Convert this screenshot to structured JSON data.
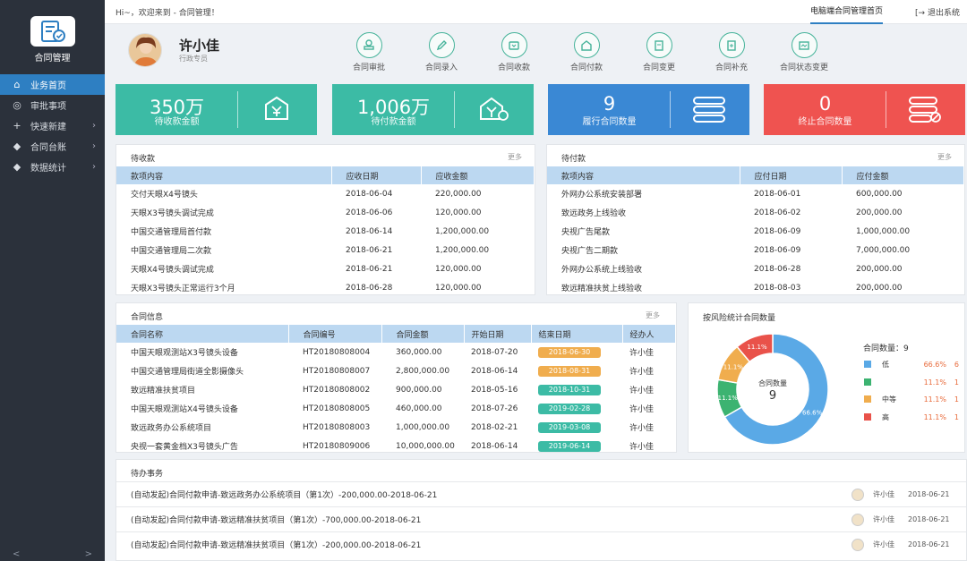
{
  "sidebar": {
    "title": "合同管理",
    "items": [
      {
        "label": "业务首页",
        "icon": "home-icon",
        "active": true,
        "has_arrow": false
      },
      {
        "label": "审批事项",
        "icon": "approval-icon",
        "active": false,
        "has_arrow": false
      },
      {
        "label": "快速新建",
        "icon": "plus-icon",
        "active": false,
        "has_arrow": true
      },
      {
        "label": "合同台账",
        "icon": "ledger-icon",
        "active": false,
        "has_arrow": true
      },
      {
        "label": "数据统计",
        "icon": "stats-icon",
        "active": false,
        "has_arrow": true
      }
    ],
    "foot_left": "<",
    "foot_right": ">"
  },
  "topbar": {
    "welcome": "Hi~，欢迎来到 - 合同管理！",
    "home_link": "电脑端合同管理首页",
    "logout": "退出系统"
  },
  "profile": {
    "name": "许小佳",
    "role": "行政专员"
  },
  "quick_actions": [
    {
      "label": "合同审批",
      "icon": "stamp-icon"
    },
    {
      "label": "合同录入",
      "icon": "pen-icon"
    },
    {
      "label": "合同收款",
      "icon": "receive-icon"
    },
    {
      "label": "合同付款",
      "icon": "pay-icon"
    },
    {
      "label": "合同变更",
      "icon": "change-icon"
    },
    {
      "label": "合同补充",
      "icon": "supplement-icon"
    },
    {
      "label": "合同状态变更",
      "icon": "status-icon"
    }
  ],
  "stats": [
    {
      "value": "350万",
      "label": "待收款金额",
      "color": "#3cbba5",
      "icon": "money-in-icon"
    },
    {
      "value": "1,006万",
      "label": "待付款金额",
      "color": "#3cbba5",
      "icon": "money-out-icon"
    },
    {
      "value": "9",
      "label": "履行合同数量",
      "color": "#3a88d4",
      "icon": "server-icon"
    },
    {
      "value": "0",
      "label": "终止合同数量",
      "color": "#ef5350",
      "icon": "server-block-icon"
    }
  ],
  "receivable": {
    "title": "待收款",
    "more": "更多",
    "headers": [
      "款项内容",
      "应收日期",
      "应收金额"
    ],
    "rows": [
      [
        "交付天眼X4号镜头",
        "2018-06-04",
        "220,000.00"
      ],
      [
        "天眼X3号镜头调试完成",
        "2018-06-06",
        "120,000.00"
      ],
      [
        "中国交通管理局首付款",
        "2018-06-14",
        "1,200,000.00"
      ],
      [
        "中国交通管理局二次款",
        "2018-06-21",
        "1,200,000.00"
      ],
      [
        "天眼X4号镜头调试完成",
        "2018-06-21",
        "120,000.00"
      ],
      [
        "天眼X3号镜头正常运行3个月",
        "2018-06-28",
        "120,000.00"
      ]
    ]
  },
  "payable": {
    "title": "待付款",
    "more": "更多",
    "headers": [
      "款项内容",
      "应付日期",
      "应付金额"
    ],
    "rows": [
      [
        "外网办公系统安装部署",
        "2018-06-01",
        "600,000.00"
      ],
      [
        "致远政务上线验收",
        "2018-06-02",
        "200,000.00"
      ],
      [
        "央视广告尾款",
        "2018-06-09",
        "1,000,000.00"
      ],
      [
        "央视广告二期款",
        "2018-06-09",
        "7,000,000.00"
      ],
      [
        "外网办公系统上线验收",
        "2018-06-28",
        "200,000.00"
      ],
      [
        "致远精准扶贫上线验收",
        "2018-08-03",
        "200,000.00"
      ]
    ]
  },
  "contracts": {
    "title": "合同信息",
    "more": "更多",
    "headers": [
      "合同名称",
      "合同编号",
      "合同金额",
      "开始日期",
      "结束日期",
      "经办人"
    ],
    "rows": [
      {
        "name": "中国天眼观测站X3号镜头设备",
        "code": "HT20180808004",
        "amount": "360,000.00",
        "start": "2018-07-20",
        "end": "2018-06-30",
        "end_color": "#f0ad4e",
        "owner": "许小佳"
      },
      {
        "name": "中国交通管理局街道全影摄像头",
        "code": "HT20180808007",
        "amount": "2,800,000.00",
        "start": "2018-06-14",
        "end": "2018-08-31",
        "end_color": "#f0ad4e",
        "owner": "许小佳"
      },
      {
        "name": "致远精准扶贫项目",
        "code": "HT20180808002",
        "amount": "900,000.00",
        "start": "2018-05-16",
        "end": "2018-10-31",
        "end_color": "#3cbba5",
        "owner": "许小佳"
      },
      {
        "name": "中国天眼观测站X4号镜头设备",
        "code": "HT20180808005",
        "amount": "460,000.00",
        "start": "2018-07-26",
        "end": "2019-02-28",
        "end_color": "#3cbba5",
        "owner": "许小佳"
      },
      {
        "name": "致远政务办公系统项目",
        "code": "HT20180808003",
        "amount": "1,000,000.00",
        "start": "2018-02-21",
        "end": "2019-03-08",
        "end_color": "#3cbba5",
        "owner": "许小佳"
      },
      {
        "name": "央视一套黄金档X3号镜头广告",
        "code": "HT20180809006",
        "amount": "10,000,000.00",
        "start": "2018-06-14",
        "end": "2019-06-14",
        "end_color": "#3cbba5",
        "owner": "许小佳"
      }
    ]
  },
  "risk": {
    "title": "按风险统计合同数量",
    "center_label": "合同数量",
    "center_value": "9",
    "legend_title": "合同数量：9",
    "chart_data": {
      "type": "pie",
      "categories": [
        "低",
        "",
        "中等",
        "高"
      ],
      "values": [
        66.6,
        11.1,
        11.1,
        11.1
      ],
      "counts": [
        6,
        1,
        1,
        1
      ],
      "percent_labels": [
        "66.6%",
        "11.1%",
        "11.1%",
        "11.1%"
      ],
      "colors": [
        "#5aa9e6",
        "#3cb371",
        "#f0ad4e",
        "#e9524a"
      ]
    }
  },
  "todo": {
    "title": "待办事务",
    "rows": [
      {
        "text": "(自动发起)合同付款申请-致远政务办公系统项目（第1次）-200,000.00-2018-06-21",
        "user": "许小佳",
        "date": "2018-06-21"
      },
      {
        "text": "(自动发起)合同付款申请-致远精准扶贫项目（第1次）-700,000.00-2018-06-21",
        "user": "许小佳",
        "date": "2018-06-21"
      },
      {
        "text": "(自动发起)合同付款申请-致远精准扶贫项目（第1次）-200,000.00-2018-06-21",
        "user": "许小佳",
        "date": "2018-06-21"
      }
    ]
  }
}
